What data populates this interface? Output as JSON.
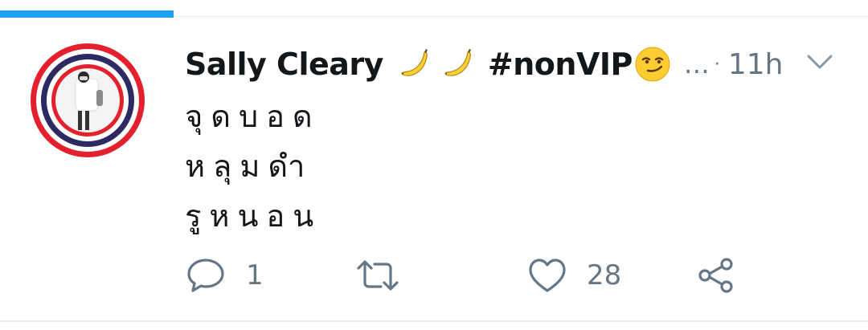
{
  "colors": {
    "progress": "#1da1f2",
    "text_primary": "#14171a",
    "text_secondary": "#657786",
    "divider": "#e6ecf0",
    "ring_red": "#e4202c",
    "ring_blue": "#2b2a63"
  },
  "progress": {
    "fraction": 0.2
  },
  "tweet": {
    "author_name": "Sally Cleary",
    "name_emoji": [
      "banana",
      "banana"
    ],
    "hashtag": "#nonVIP",
    "hashtag_emoji": "smirking-face",
    "ellipsis": "…",
    "separator": "·",
    "time": "11h",
    "lines": [
      "จุดบอด",
      "หลุมดำ",
      "รูหนอน"
    ],
    "actions": {
      "reply_count": "1",
      "retweet_count": "",
      "like_count": "28"
    }
  }
}
